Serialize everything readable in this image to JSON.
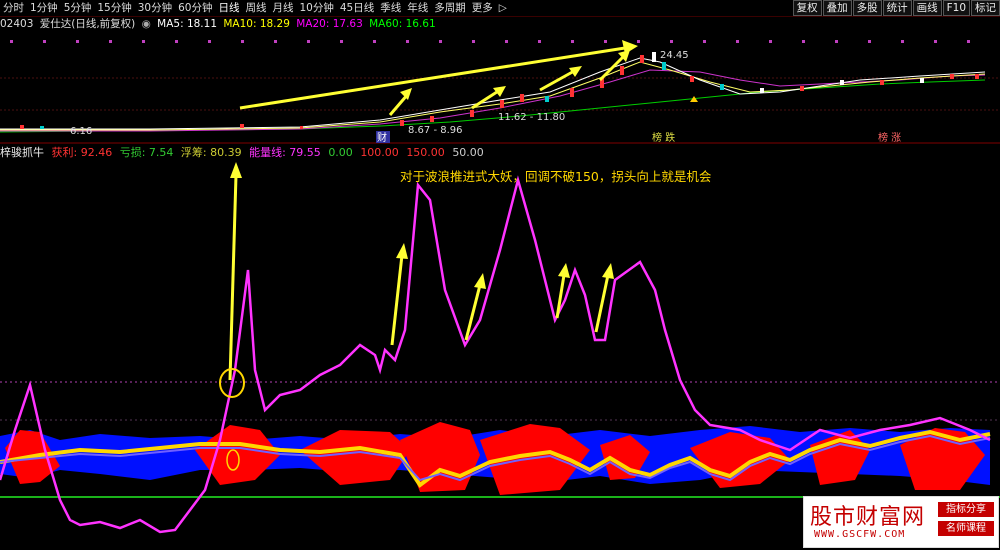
{
  "toolbar": {
    "periods": [
      "分时",
      "1分钟",
      "5分钟",
      "15分钟",
      "30分钟",
      "60分钟",
      "日线",
      "周线",
      "月线",
      "10分钟",
      "45日线",
      "季线",
      "年线",
      "多周期",
      "更多"
    ],
    "active_period": "日线",
    "more_arrow": "▷",
    "right_buttons": [
      "复权",
      "叠加",
      "多股",
      "统计",
      "画线",
      "F10",
      "标记"
    ]
  },
  "main_chart": {
    "code": "02403",
    "name": "爱仕达(日线,前复权)",
    "ma5": "MA5: 18.11",
    "ma10": "MA10: 18.29",
    "ma20": "MA20: 17.63",
    "ma60": "MA60: 16.61",
    "price_labels": {
      "high": "24.45",
      "low_left": "6.16",
      "range_mid": "8.67 - 8.96",
      "range_right": "11.62 - 11.80",
      "marker_cai": "财",
      "event1": "榜 跌",
      "event2": "榜 涨"
    },
    "colors": {
      "ma5": "#ffffff",
      "ma10": "#ffff00",
      "ma20": "#ff00ff",
      "ma60": "#00ff00"
    }
  },
  "indicator": {
    "name": "梓骏抓牛",
    "profit": "获利: 92.46",
    "loss": "亏损: 7.54",
    "float": "浮筹: 80.39",
    "energy": "能量线: 79.55",
    "zero": "0.00",
    "l100": "100.00",
    "l150": "150.00",
    "l50": "50.00",
    "annotation": "对于波浪推进式大妖，回调不破150，拐头向上就是机会",
    "colors": {
      "energy": "#ff33ff",
      "profit_band": "#ff0000",
      "loss_band": "#0000ff",
      "float_line": "#ffd700",
      "zero_line": "#00ff00"
    }
  },
  "watermark": {
    "main": "股市财富网",
    "tag1": "指标分享",
    "tag2": "名师课程",
    "url": "WWW.GSCFW.COM"
  }
}
